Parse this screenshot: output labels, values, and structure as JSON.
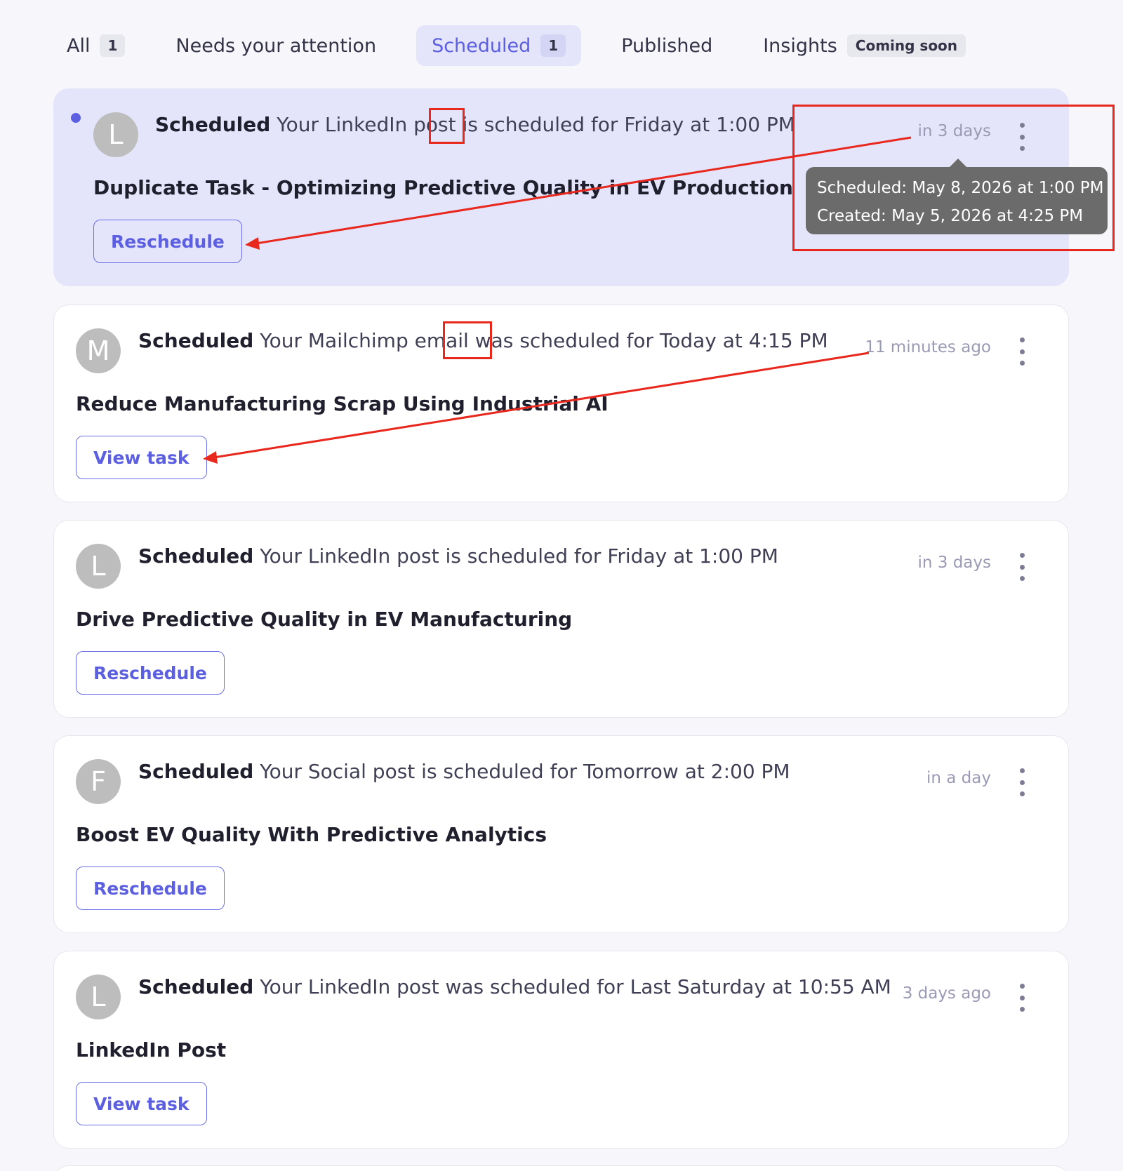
{
  "tabs": [
    {
      "label": "All",
      "count": "1"
    },
    {
      "label": "Needs your attention"
    },
    {
      "label": "Scheduled",
      "count": "1"
    },
    {
      "label": "Published"
    },
    {
      "label": "Insights",
      "badge": "Coming soon"
    }
  ],
  "cards": [
    {
      "avatar": "L",
      "status": "Scheduled",
      "message_pre": "Your LinkedIn post",
      "message_word": "is",
      "message_post": "scheduled for Friday at 1:00 PM",
      "time": "in 3 days",
      "title": "Duplicate Task - Optimizing Predictive Quality in EV Production",
      "button": "Reschedule"
    },
    {
      "avatar": "M",
      "status": "Scheduled",
      "message_pre": "Your Mailchimp email",
      "message_word": "was",
      "message_post": "scheduled for Today at 4:15 PM",
      "time": "11 minutes ago",
      "title": "Reduce Manufacturing Scrap Using Industrial AI",
      "button": "View task"
    },
    {
      "avatar": "L",
      "status": "Scheduled",
      "message": "Your LinkedIn post is scheduled for Friday at 1:00 PM",
      "time": "in 3 days",
      "title": "Drive Predictive Quality in EV Manufacturing",
      "button": "Reschedule"
    },
    {
      "avatar": "F",
      "status": "Scheduled",
      "message": "Your Social post is scheduled for Tomorrow at 2:00 PM",
      "time": "in a day",
      "title": "Boost EV Quality With Predictive Analytics",
      "button": "Reschedule"
    },
    {
      "avatar": "L",
      "status": "Scheduled",
      "message": "Your LinkedIn post was scheduled for Last Saturday at 10:55 AM",
      "time": "3 days ago",
      "title": "LinkedIn Post",
      "button": "View task"
    }
  ],
  "tooltip": {
    "scheduled": "Scheduled: May 8, 2026 at 1:00 PM",
    "created": "Created: May 5, 2026 at 4:25 PM"
  },
  "colors": {
    "accent": "#5b5fe0",
    "highlight_bg": "#e4e4fb",
    "annotation": "#e8271d"
  }
}
